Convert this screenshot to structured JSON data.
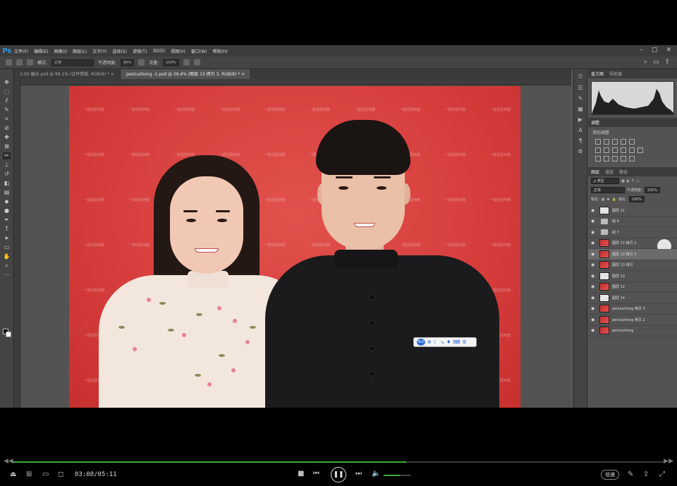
{
  "menubar": {
    "app_logo": "Ps",
    "items": [
      "文件(F)",
      "编辑(E)",
      "图像(I)",
      "图层(L)",
      "文字(Y)",
      "选择(S)",
      "滤镜(T)",
      "3D(D)",
      "视图(V)",
      "窗口(W)",
      "帮助(H)"
    ],
    "window_controls": [
      "–",
      "▢",
      "✕"
    ]
  },
  "options": {
    "mode_label": "模式:",
    "mode_value": "正常",
    "opacity_label": "不透明度:",
    "opacity_value": "80%",
    "flow_label": "流量:",
    "flow_value": "100%"
  },
  "tabs": [
    {
      "label": "1-02 婚纱.psd @ 89.1% (证件照版, RGB/8) *  ×"
    },
    {
      "label": "peixiuzhong -1.psd @ 29.4% (图层 13 拷贝 3, RGB/8) *  ×"
    }
  ],
  "watermark_text": "一键抠图神器",
  "floatbar": {
    "logo": "PLO",
    "icons": [
      "⊕",
      "☾",
      "↘",
      "♦",
      "⌨",
      "⚙"
    ]
  },
  "panels": {
    "top_tabs": [
      "直方图",
      "导航器"
    ],
    "adjust_tab": "调整",
    "adjust_title": "添加调整",
    "layer_tabs": [
      "图层",
      "通道",
      "路径"
    ],
    "kind_label": "ρ 类型",
    "blend_mode": "正常",
    "opacity_label": "不透明度:",
    "opacity_value": "100%",
    "lock_label": "锁定:",
    "fill_label": "填充:",
    "fill_value": "100%",
    "layers": [
      {
        "name": "图层 11",
        "thumb": "checker",
        "selected": false
      },
      {
        "name": "组 6",
        "thumb": "folder",
        "selected": false
      },
      {
        "name": "组 7",
        "thumb": "folder",
        "selected": false
      },
      {
        "name": "图层 13 拷贝 2",
        "thumb": "red",
        "selected": false
      },
      {
        "name": "图层 13 拷贝 3",
        "thumb": "red",
        "selected": true
      },
      {
        "name": "图层 13 拷贝",
        "thumb": "red",
        "selected": false
      },
      {
        "name": "图层 13",
        "thumb": "checker",
        "selected": false
      },
      {
        "name": "图层 12",
        "thumb": "red",
        "selected": false
      },
      {
        "name": "图层 14",
        "thumb": "checker",
        "selected": false
      },
      {
        "name": "peixiuzhong 拷贝 3",
        "thumb": "red",
        "selected": false
      },
      {
        "name": "peixiuzhong 拷贝 2",
        "thumb": "red",
        "selected": false
      },
      {
        "name": "peixiuzhong",
        "thumb": "red",
        "selected": false
      }
    ]
  },
  "player": {
    "current_time": "03:08",
    "total_time": "05:11",
    "time_display": "03:08/05:11",
    "progress_fraction": 0.604,
    "volume_fraction": 0.6,
    "speed_label": "倍速"
  },
  "colors": {
    "accent_green": "#3fae3c",
    "ps_blue": "#31a8ff",
    "backdrop_red": "#d63f3d"
  }
}
